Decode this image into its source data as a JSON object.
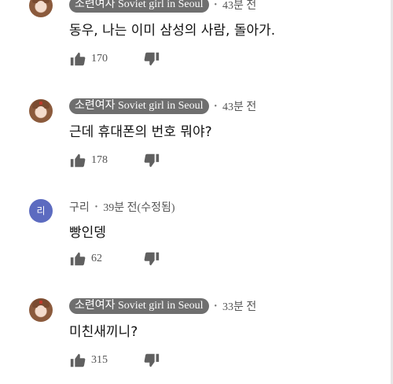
{
  "comments": [
    {
      "author": "소련여자 Soviet girl in Seoul",
      "separator": "•",
      "time": "43분 전",
      "text": "동우, 나는 이미 삼성의 사람, 돌아가.",
      "likes": "170"
    },
    {
      "author": "소련여자 Soviet girl in Seoul",
      "separator": "•",
      "time": "43분 전",
      "text": "근데 휴대폰의 번호 뭐야?",
      "likes": "178"
    },
    {
      "author": "구리",
      "avatar_letter": "리",
      "separator": "•",
      "time": "39분 전(수정됨)",
      "text": "빵인뎅",
      "likes": "62"
    },
    {
      "author": "소련여자 Soviet girl in Seoul",
      "separator": "•",
      "time": "33분 전",
      "text": "미친새끼니?",
      "likes": "315"
    }
  ],
  "colors": {
    "name_chip_bg": "#6f6f6f",
    "letter_avatar_bg": "#5c6bc0",
    "icon_gray": "#606060"
  },
  "icons": {
    "like": "thumb-up-icon",
    "dislike": "thumb-down-icon"
  }
}
